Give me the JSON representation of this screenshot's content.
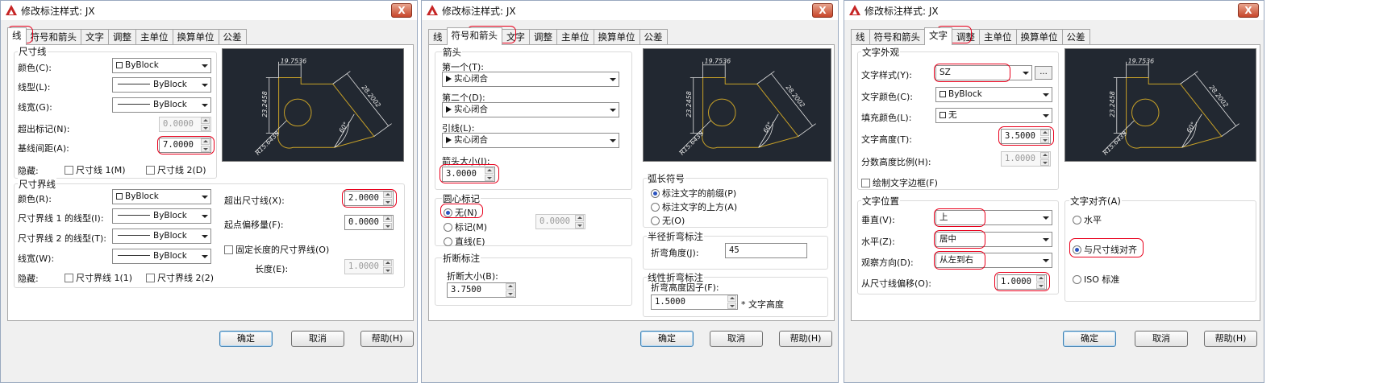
{
  "window": {
    "title": "修改标注样式: JX",
    "close_label": "X"
  },
  "tabs": [
    "线",
    "符号和箭头",
    "文字",
    "调整",
    "主单位",
    "换算单位",
    "公差"
  ],
  "buttons": {
    "ok": "确定",
    "cancel": "取消",
    "help": "帮助(H)"
  },
  "preview_dims": {
    "top": "19.7536",
    "left": "23.2458",
    "right": "28.2002",
    "angle": "60°",
    "radius": "R15.6439"
  },
  "lines_tab": {
    "dimline_group": "尺寸线",
    "color_label": "颜色(C):",
    "color_value": "ByBlock",
    "linetype_label": "线型(L):",
    "linetype_value": "ByBlock",
    "lineweight_label": "线宽(G):",
    "lineweight_value": "ByBlock",
    "extend_ticks_label": "超出标记(N):",
    "extend_ticks_value": "0.0000",
    "baseline_label": "基线间距(A):",
    "baseline_value": "7.0000",
    "suppress_label": "隐藏:",
    "suppress_dim1": "尺寸线 1(M)",
    "suppress_dim2": "尺寸线 2(D)",
    "extline_group": "尺寸界线",
    "ext_color_label": "颜色(R):",
    "ext_color_value": "ByBlock",
    "ext1_linetype_label": "尺寸界线 1 的线型(I):",
    "ext1_linetype_value": "ByBlock",
    "ext2_linetype_label": "尺寸界线 2 的线型(T):",
    "ext2_linetype_value": "ByBlock",
    "ext_weight_label": "线宽(W):",
    "ext_weight_value": "ByBlock",
    "ext_suppress_label": "隐藏:",
    "ext_suppress1": "尺寸界线 1(1)",
    "ext_suppress2": "尺寸界线 2(2)",
    "beyond_label": "超出尺寸线(X):",
    "beyond_value": "2.0000",
    "offset_label": "起点偏移量(F):",
    "offset_value": "0.0000",
    "fixed_label": "固定长度的尺寸界线(O)",
    "length_label": "长度(E):",
    "length_value": "1.0000"
  },
  "symbols_tab": {
    "arrow_group": "箭头",
    "first_label": "第一个(T):",
    "first_value": "实心闭合",
    "second_label": "第二个(D):",
    "second_value": "实心闭合",
    "leader_label": "引线(L):",
    "leader_value": "实心闭合",
    "size_label": "箭头大小(I):",
    "size_value": "3.0000",
    "center_group": "圆心标记",
    "none_label": "无(N)",
    "mark_label": "标记(M)",
    "line_label": "直线(E)",
    "center_value": "0.0000",
    "break_group": "折断标注",
    "break_size_label": "折断大小(B):",
    "break_size_value": "3.7500",
    "arc_group": "弧长符号",
    "arc_prefix": "标注文字的前缀(P)",
    "arc_above": "标注文字的上方(A)",
    "arc_none": "无(O)",
    "radius_group": "半径折弯标注",
    "jog_angle_label": "折弯角度(J):",
    "jog_angle_value": "45",
    "linear_group": "线性折弯标注",
    "jog_factor_label": "折弯高度因子(F):",
    "jog_factor_value": "1.5000",
    "jog_factor_suffix": "* 文字高度"
  },
  "text_tab": {
    "appearance_group": "文字外观",
    "style_label": "文字样式(Y):",
    "style_value": "SZ",
    "style_btn": "...",
    "color_label": "文字颜色(C):",
    "color_value": "ByBlock",
    "fill_label": "填充颜色(L):",
    "fill_value": "无",
    "height_label": "文字高度(T):",
    "height_value": "3.5000",
    "fraction_label": "分数高度比例(H):",
    "fraction_value": "1.0000",
    "frame_label": "绘制文字边框(F)",
    "placement_group": "文字位置",
    "vertical_label": "垂直(V):",
    "vertical_value": "上",
    "horizontal_label": "水平(Z):",
    "horizontal_value": "居中",
    "direction_label": "观察方向(D):",
    "direction_value": "从左到右",
    "offset_label": "从尺寸线偏移(O):",
    "offset_value": "1.0000",
    "align_group": "文字对齐(A)",
    "align_horizontal": "水平",
    "align_dim": "与尺寸线对齐",
    "align_iso": "ISO 标准"
  }
}
